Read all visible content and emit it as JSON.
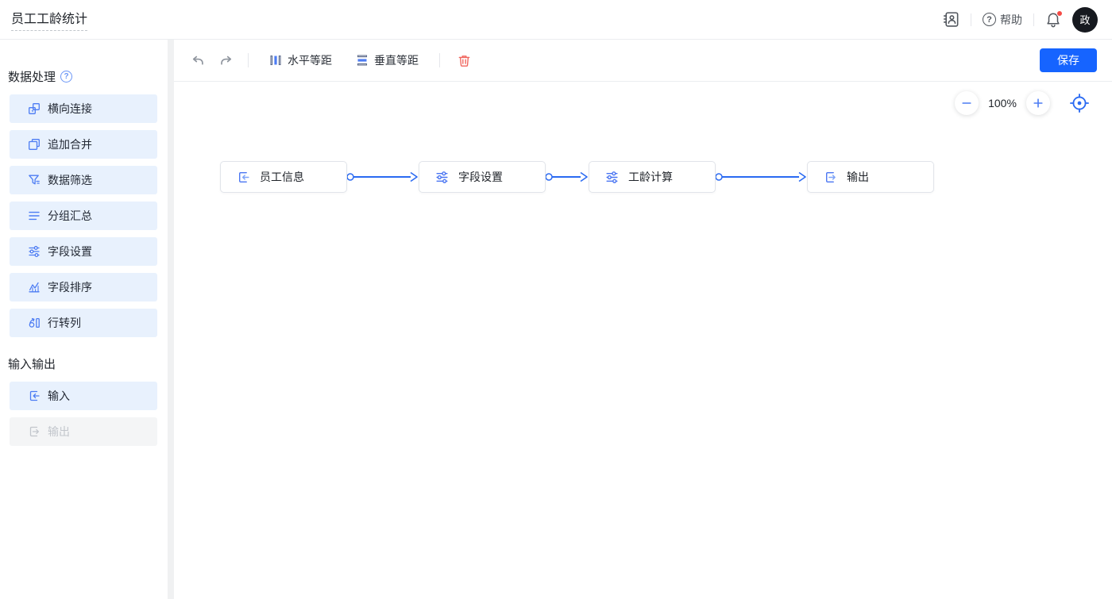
{
  "header": {
    "title": "员工工龄统计",
    "help_label": "帮助",
    "avatar_text": "政"
  },
  "sidebar": {
    "section1_title": "数据处理",
    "section2_title": "输入输出",
    "items1": [
      {
        "label": "横向连接",
        "icon": "horizontal-join-icon"
      },
      {
        "label": "追加合并",
        "icon": "append-merge-icon"
      },
      {
        "label": "数据筛选",
        "icon": "filter-icon"
      },
      {
        "label": "分组汇总",
        "icon": "group-summary-icon"
      },
      {
        "label": "字段设置",
        "icon": "field-settings-icon"
      },
      {
        "label": "字段排序",
        "icon": "field-sort-icon"
      },
      {
        "label": "行转列",
        "icon": "row-to-column-icon"
      }
    ],
    "items2": [
      {
        "label": "输入",
        "icon": "input-icon",
        "disabled": false
      },
      {
        "label": "输出",
        "icon": "output-icon",
        "disabled": true
      }
    ]
  },
  "toolbar": {
    "horizontal_spacing_label": "水平等距",
    "vertical_spacing_label": "垂直等距",
    "save_label": "保存"
  },
  "canvas": {
    "zoom_level": "100%",
    "nodes": [
      {
        "label": "员工信息",
        "icon": "input-icon"
      },
      {
        "label": "字段设置",
        "icon": "field-settings-icon"
      },
      {
        "label": "工龄计算",
        "icon": "field-settings-icon"
      },
      {
        "label": "输出",
        "icon": "output-icon"
      }
    ],
    "connections": [
      {
        "from": "员工信息",
        "to": "字段设置"
      },
      {
        "from": "字段设置",
        "to": "工龄计算"
      },
      {
        "from": "工龄计算",
        "to": "输出"
      }
    ]
  },
  "colors": {
    "primary": "#1664ff",
    "icon_blue": "#4c7cf3",
    "item_bg": "#e8f1fd",
    "connection": "#2a6af2",
    "danger": "#f0665e",
    "badge_red": "#f54a45"
  }
}
